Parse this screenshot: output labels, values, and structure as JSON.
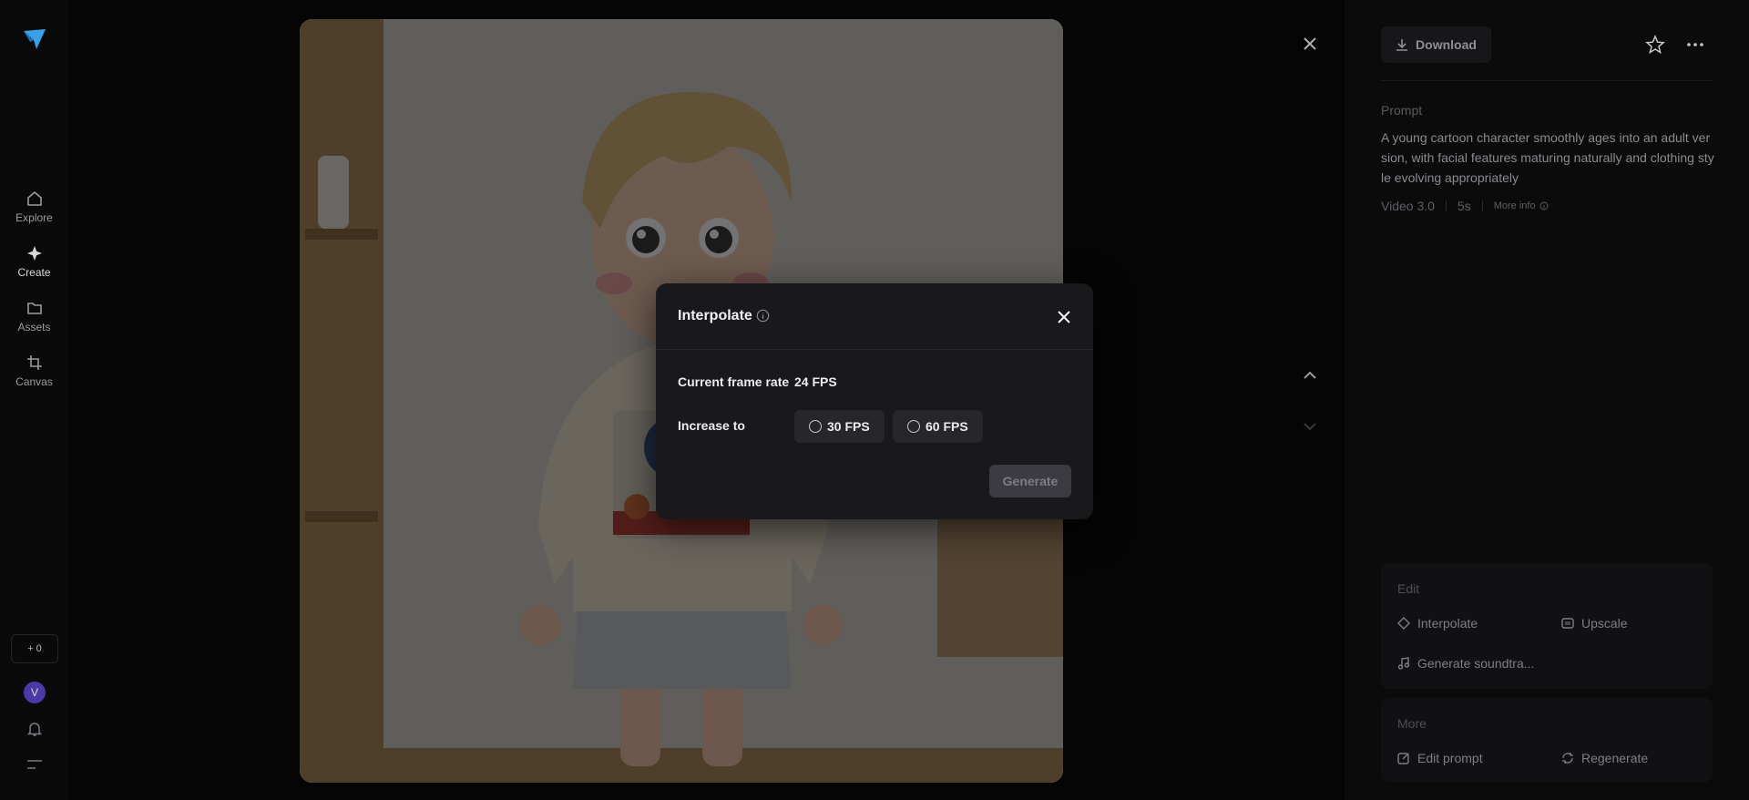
{
  "nav": {
    "items": [
      {
        "label": "Explore",
        "icon": "home-icon"
      },
      {
        "label": "Create",
        "icon": "sparkle-icon"
      },
      {
        "label": "Assets",
        "icon": "folder-icon"
      },
      {
        "label": "Canvas",
        "icon": "crop-icon"
      }
    ],
    "credits": "+ 0",
    "avatar_initial": "V"
  },
  "toolbar": {
    "download_label": "Download"
  },
  "details": {
    "prompt_label": "Prompt",
    "prompt_text": "A young cartoon character smoothly ages into an adult version, with facial features maturing naturally and clothing style evolving appropriately",
    "model": "Video 3.0",
    "duration": "5s",
    "more_info_label": "More info"
  },
  "edit_section": {
    "title": "Edit",
    "actions": [
      {
        "label": "Interpolate",
        "icon": "diamond-icon"
      },
      {
        "label": "Upscale",
        "icon": "hd-icon"
      },
      {
        "label": "Generate soundtra...",
        "icon": "music-note-icon"
      }
    ]
  },
  "more_section": {
    "title": "More",
    "actions": [
      {
        "label": "Edit prompt",
        "icon": "edit-icon"
      },
      {
        "label": "Regenerate",
        "icon": "refresh-icon"
      }
    ]
  },
  "modal": {
    "title": "Interpolate",
    "current_label": "Current frame rate",
    "current_value": "24 FPS",
    "increase_label": "Increase to",
    "options": [
      "30 FPS",
      "60 FPS"
    ],
    "generate_label": "Generate"
  },
  "colors": {
    "background": "#050505",
    "panel": "#0b0b0c",
    "modal": "#19191c",
    "accent_logo": "#3aa0e8",
    "avatar": "#4a3aa8"
  }
}
